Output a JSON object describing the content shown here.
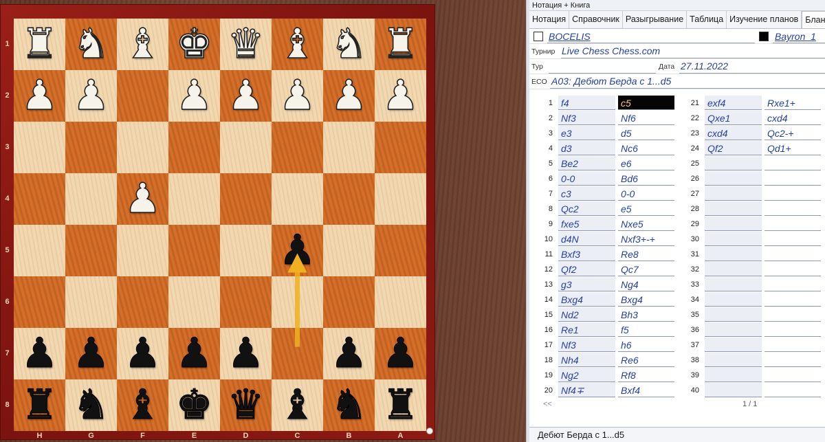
{
  "board": {
    "files": [
      "H",
      "G",
      "F",
      "E",
      "D",
      "C",
      "B",
      "A"
    ],
    "ranks": [
      "1",
      "2",
      "3",
      "4",
      "5",
      "6",
      "7",
      "8"
    ],
    "rows": [
      [
        "wR",
        "wN",
        "wB",
        "wK",
        "wQ",
        "wB",
        "wN",
        "wR"
      ],
      [
        "wP",
        "wP",
        "",
        "wP",
        "wP",
        "wP",
        "wP",
        "wP"
      ],
      [
        "",
        "",
        "",
        "",
        "",
        "",
        "",
        ""
      ],
      [
        "",
        "",
        "wP",
        "",
        "",
        "",
        "",
        ""
      ],
      [
        "",
        "",
        "",
        "",
        "",
        "bP",
        "",
        ""
      ],
      [
        "",
        "",
        "",
        "",
        "",
        "",
        "",
        ""
      ],
      [
        "bP",
        "bP",
        "bP",
        "bP",
        "bP",
        "",
        "bP",
        "bP"
      ],
      [
        "bR",
        "bN",
        "bB",
        "bK",
        "bQ",
        "bB",
        "bN",
        "bR"
      ]
    ],
    "arrow_color": "#f0b020"
  },
  "panel": {
    "title": "Нотация + Книга",
    "tabs": [
      "Нотация",
      "Справочник",
      "Разыгрывание",
      "Таблица",
      "Изучение планов",
      "Бланк"
    ],
    "white_player": "BOCELIS",
    "black_player": "Bayron_1",
    "tournament_label": "Турнир",
    "tournament": "Live Chess Chess.com",
    "round_label": "Тур",
    "round": "",
    "date_label": "Дата",
    "date": "27.11.2022",
    "eco_label": "ECO",
    "eco": "A03: Дебют Берда с 1...d5",
    "pager_prev": "<<",
    "pager_count": "1 / 1",
    "status": "Дебют Берда с 1...d5"
  },
  "moves": [
    {
      "n": "1",
      "w": "f4",
      "b": "c5"
    },
    {
      "n": "2",
      "w": "Nf3",
      "b": "Nf6"
    },
    {
      "n": "3",
      "w": "e3",
      "b": "d5"
    },
    {
      "n": "4",
      "w": "d3",
      "b": "Nc6"
    },
    {
      "n": "5",
      "w": "Be2",
      "b": "e6"
    },
    {
      "n": "6",
      "w": "0-0",
      "b": "Bd6"
    },
    {
      "n": "7",
      "w": "c3",
      "b": "0-0"
    },
    {
      "n": "8",
      "w": "Qc2",
      "b": "e5"
    },
    {
      "n": "9",
      "w": "fxe5",
      "b": "Nxe5"
    },
    {
      "n": "10",
      "w": "d4N",
      "b": "Nxf3+-+"
    },
    {
      "n": "11",
      "w": "Bxf3",
      "b": "Re8"
    },
    {
      "n": "12",
      "w": "Qf2",
      "b": "Qc7"
    },
    {
      "n": "13",
      "w": "g3",
      "b": "Ng4"
    },
    {
      "n": "14",
      "w": "Bxg4",
      "b": "Bxg4"
    },
    {
      "n": "15",
      "w": "Nd2",
      "b": "Bh3"
    },
    {
      "n": "16",
      "w": "Re1",
      "b": "f5"
    },
    {
      "n": "17",
      "w": "Nf3",
      "b": "h6"
    },
    {
      "n": "18",
      "w": "Nh4",
      "b": "Re6"
    },
    {
      "n": "19",
      "w": "Ng2",
      "b": "Rf8"
    },
    {
      "n": "20",
      "w": "Nf4∓",
      "b": "Bxf4"
    },
    {
      "n": "21",
      "w": "exf4",
      "b": "Rxe1+"
    },
    {
      "n": "22",
      "w": "Qxe1",
      "b": "cxd4"
    },
    {
      "n": "23",
      "w": "cxd4",
      "b": "Qc2-+"
    },
    {
      "n": "24",
      "w": "Qf2",
      "b": "Qd1+"
    },
    {
      "n": "25",
      "w": "",
      "b": ""
    },
    {
      "n": "26",
      "w": "",
      "b": ""
    },
    {
      "n": "27",
      "w": "",
      "b": ""
    },
    {
      "n": "28",
      "w": "",
      "b": ""
    },
    {
      "n": "29",
      "w": "",
      "b": ""
    },
    {
      "n": "30",
      "w": "",
      "b": ""
    },
    {
      "n": "31",
      "w": "",
      "b": ""
    },
    {
      "n": "32",
      "w": "",
      "b": ""
    },
    {
      "n": "33",
      "w": "",
      "b": ""
    },
    {
      "n": "34",
      "w": "",
      "b": ""
    },
    {
      "n": "35",
      "w": "",
      "b": ""
    },
    {
      "n": "36",
      "w": "",
      "b": ""
    },
    {
      "n": "37",
      "w": "",
      "b": ""
    },
    {
      "n": "38",
      "w": "",
      "b": ""
    },
    {
      "n": "39",
      "w": "",
      "b": ""
    },
    {
      "n": "40",
      "w": "",
      "b": ""
    }
  ],
  "current_move": {
    "index": 0,
    "side": "b"
  },
  "last_move_arrow": {
    "from": "c7",
    "to": "c5"
  }
}
